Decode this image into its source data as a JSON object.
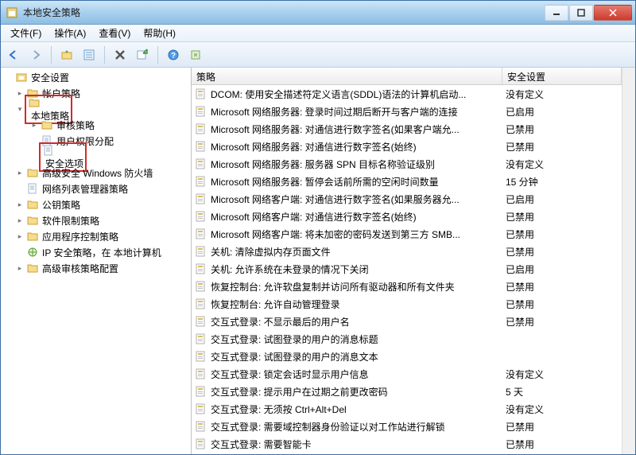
{
  "window": {
    "title": "本地安全策略"
  },
  "menu": {
    "file": "文件(F)",
    "action": "操作(A)",
    "view": "查看(V)",
    "help": "帮助(H)"
  },
  "tree": {
    "root": "安全设置",
    "nodes": [
      {
        "label": "帐户策略",
        "depth": 1,
        "expandable": true
      },
      {
        "label": "本地策略",
        "depth": 1,
        "expandable": true,
        "highlight": true,
        "expanded": true
      },
      {
        "label": "审核策略",
        "depth": 2,
        "expandable": true
      },
      {
        "label": "用户权限分配",
        "depth": 2,
        "expandable": false
      },
      {
        "label": "安全选项",
        "depth": 2,
        "expandable": false,
        "highlight": true
      },
      {
        "label": "高级安全 Windows 防火墙",
        "depth": 1,
        "expandable": true
      },
      {
        "label": "网络列表管理器策略",
        "depth": 1,
        "expandable": false
      },
      {
        "label": "公钥策略",
        "depth": 1,
        "expandable": true
      },
      {
        "label": "软件限制策略",
        "depth": 1,
        "expandable": true
      },
      {
        "label": "应用程序控制策略",
        "depth": 1,
        "expandable": true
      },
      {
        "label": "IP 安全策略，在 本地计算机",
        "depth": 1,
        "expandable": false,
        "icon": "ip"
      },
      {
        "label": "高级审核策略配置",
        "depth": 1,
        "expandable": true
      }
    ]
  },
  "columns": {
    "policy": "策略",
    "setting": "安全设置"
  },
  "rows": [
    {
      "policy": "DCOM: 使用安全描述符定义语言(SDDL)语法的计算机启动...",
      "setting": "没有定义"
    },
    {
      "policy": "Microsoft 网络服务器: 登录时间过期后断开与客户端的连接",
      "setting": "已启用"
    },
    {
      "policy": "Microsoft 网络服务器: 对通信进行数字签名(如果客户端允...",
      "setting": "已禁用"
    },
    {
      "policy": "Microsoft 网络服务器: 对通信进行数字签名(始终)",
      "setting": "已禁用"
    },
    {
      "policy": "Microsoft 网络服务器: 服务器 SPN 目标名称验证级别",
      "setting": "没有定义"
    },
    {
      "policy": "Microsoft 网络服务器: 暂停会话前所需的空闲时间数量",
      "setting": "15 分钟"
    },
    {
      "policy": "Microsoft 网络客户端: 对通信进行数字签名(如果服务器允...",
      "setting": "已启用"
    },
    {
      "policy": "Microsoft 网络客户端: 对通信进行数字签名(始终)",
      "setting": "已禁用"
    },
    {
      "policy": "Microsoft 网络客户端: 将未加密的密码发送到第三方 SMB...",
      "setting": "已禁用"
    },
    {
      "policy": "关机: 清除虚拟内存页面文件",
      "setting": "已禁用"
    },
    {
      "policy": "关机: 允许系统在未登录的情况下关闭",
      "setting": "已启用"
    },
    {
      "policy": "恢复控制台: 允许软盘复制并访问所有驱动器和所有文件夹",
      "setting": "已禁用"
    },
    {
      "policy": "恢复控制台: 允许自动管理登录",
      "setting": "已禁用"
    },
    {
      "policy": "交互式登录: 不显示最后的用户名",
      "setting": "已禁用"
    },
    {
      "policy": "交互式登录: 试图登录的用户的消息标题",
      "setting": ""
    },
    {
      "policy": "交互式登录: 试图登录的用户的消息文本",
      "setting": ""
    },
    {
      "policy": "交互式登录: 锁定会话时显示用户信息",
      "setting": "没有定义"
    },
    {
      "policy": "交互式登录: 提示用户在过期之前更改密码",
      "setting": "5 天"
    },
    {
      "policy": "交互式登录: 无须按 Ctrl+Alt+Del",
      "setting": "没有定义"
    },
    {
      "policy": "交互式登录: 需要域控制器身份验证以对工作站进行解锁",
      "setting": "已禁用"
    },
    {
      "policy": "交互式登录: 需要智能卡",
      "setting": "已禁用"
    }
  ]
}
